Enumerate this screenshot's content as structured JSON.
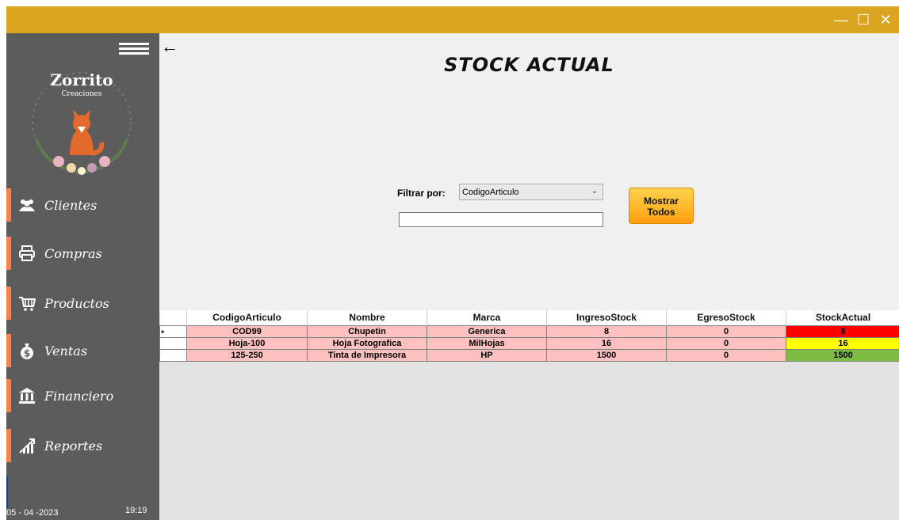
{
  "window": {
    "controls": {
      "minimize": "—",
      "maximize": "☐",
      "close": "✕"
    },
    "accent_color": "#daa520"
  },
  "sidebar": {
    "background": "#5c5c5c",
    "accent_color": "#ff7f50",
    "logo_text": [
      "Zorrito",
      "Creaciones"
    ],
    "items": [
      {
        "label": "Clientes",
        "icon": "users-icon"
      },
      {
        "label": "Compras",
        "icon": "printer-icon"
      },
      {
        "label": "Productos",
        "icon": "cart-icon"
      },
      {
        "label": "Ventas",
        "icon": "money-bag-icon"
      },
      {
        "label": "Financiero",
        "icon": "bank-icon"
      },
      {
        "label": "Reportes",
        "icon": "chart-growth-icon"
      }
    ],
    "date": "05 - 04 -2023",
    "time": "19:19"
  },
  "main": {
    "title": "STOCK ACTUAL",
    "filter": {
      "label": "Filtrar por:",
      "selected": "CodigoArticulo",
      "input_value": ""
    },
    "show_all_button": {
      "line1": "Mostrar",
      "line2": "Todos"
    }
  },
  "grid": {
    "columns": [
      "CodigoArticulo",
      "Nombre",
      "Marca",
      "IngresoStock",
      "EgresoStock",
      "StockActual"
    ],
    "rows": [
      {
        "CodigoArticulo": "COD99",
        "Nombre": "Chupetin",
        "Marca": "Generica",
        "IngresoStock": "8",
        "EgresoStock": "0",
        "StockActual": "8",
        "status_color": "#ff0000"
      },
      {
        "CodigoArticulo": "Hoja-100",
        "Nombre": "Hoja Fotografica",
        "Marca": "MilHojas",
        "IngresoStock": "16",
        "EgresoStock": "0",
        "StockActual": "16",
        "status_color": "#ffff00"
      },
      {
        "CodigoArticulo": "125-250",
        "Nombre": "Tinta de Impresora",
        "Marca": "HP",
        "IngresoStock": "1500",
        "EgresoStock": "0",
        "StockActual": "1500",
        "status_color": "#7cbd42"
      }
    ],
    "current_row_marker": "▸"
  }
}
